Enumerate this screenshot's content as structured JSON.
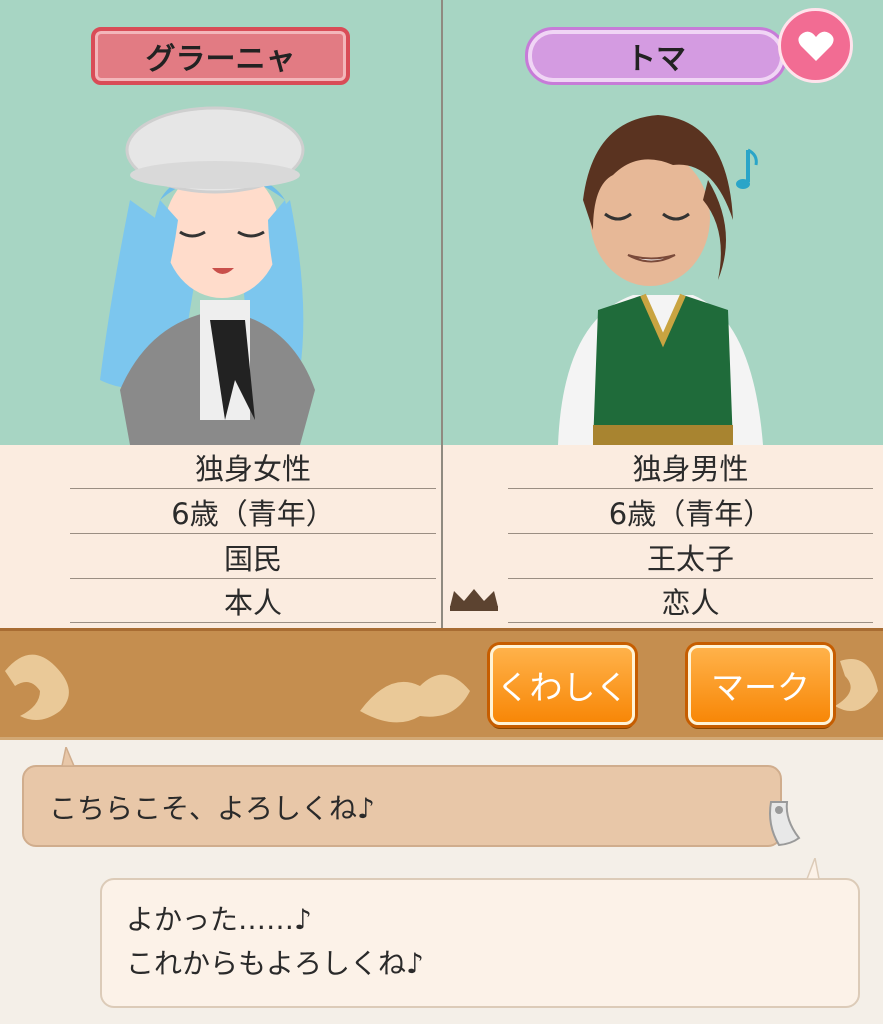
{
  "characters": {
    "left": {
      "name": "グラーニャ",
      "info": [
        "独身女性",
        "6歳（青年）",
        "国民",
        "本人"
      ],
      "color": "#e27b83"
    },
    "right": {
      "name": "トマ",
      "info": [
        "独身男性",
        "6歳（青年）",
        "王太子",
        "恋人"
      ],
      "color": "#d49be1"
    }
  },
  "buttons": {
    "details_label": "くわしく",
    "mark_label": "マーク"
  },
  "chat": {
    "left_message": "こちらこそ、よろしくね♪",
    "right_message_line1": "よかった……♪",
    "right_message_line2": "これからもよろしくね♪"
  },
  "icons": {
    "heart": "heart-icon",
    "crown": "crown-icon"
  },
  "colors": {
    "portrait_bg": "#a7d5c3",
    "action_bar": "#c58e4f",
    "button_orange": "#f88707"
  }
}
